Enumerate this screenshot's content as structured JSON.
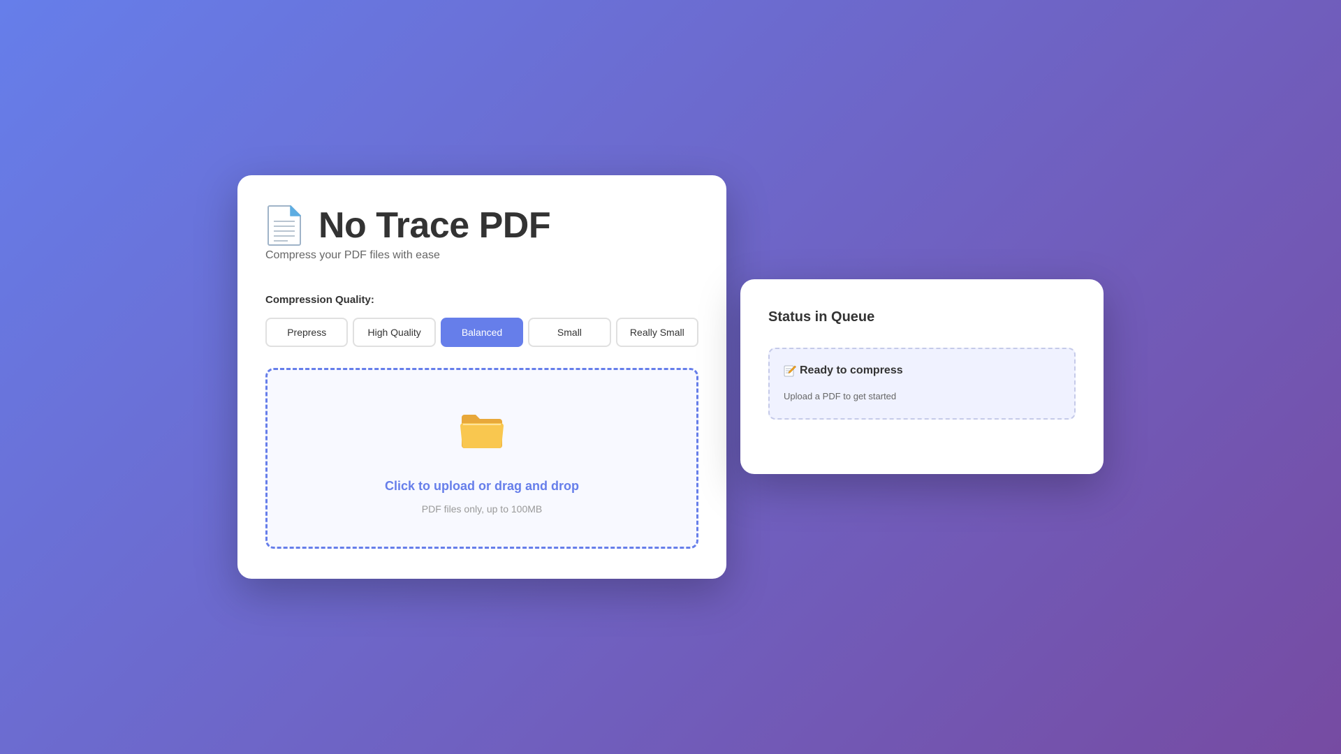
{
  "app": {
    "title": "No Trace PDF",
    "subtitle": "Compress your PDF files with ease",
    "title_icon": "document-icon"
  },
  "compression": {
    "label": "Compression Quality:",
    "options": [
      "Prepress",
      "High Quality",
      "Balanced",
      "Small",
      "Really Small"
    ],
    "selected": "Balanced"
  },
  "upload": {
    "icon": "folder-icon",
    "text": "Click to upload or drag and drop",
    "hint": "PDF files only, up to 100MB"
  },
  "status": {
    "title": "Status in Queue",
    "icon": "memo-icon",
    "heading": "Ready to compress",
    "message": "Upload a PDF to get started"
  },
  "colors": {
    "accent": "#667eea",
    "gradient_start": "#667eea",
    "gradient_end": "#764ba2"
  }
}
